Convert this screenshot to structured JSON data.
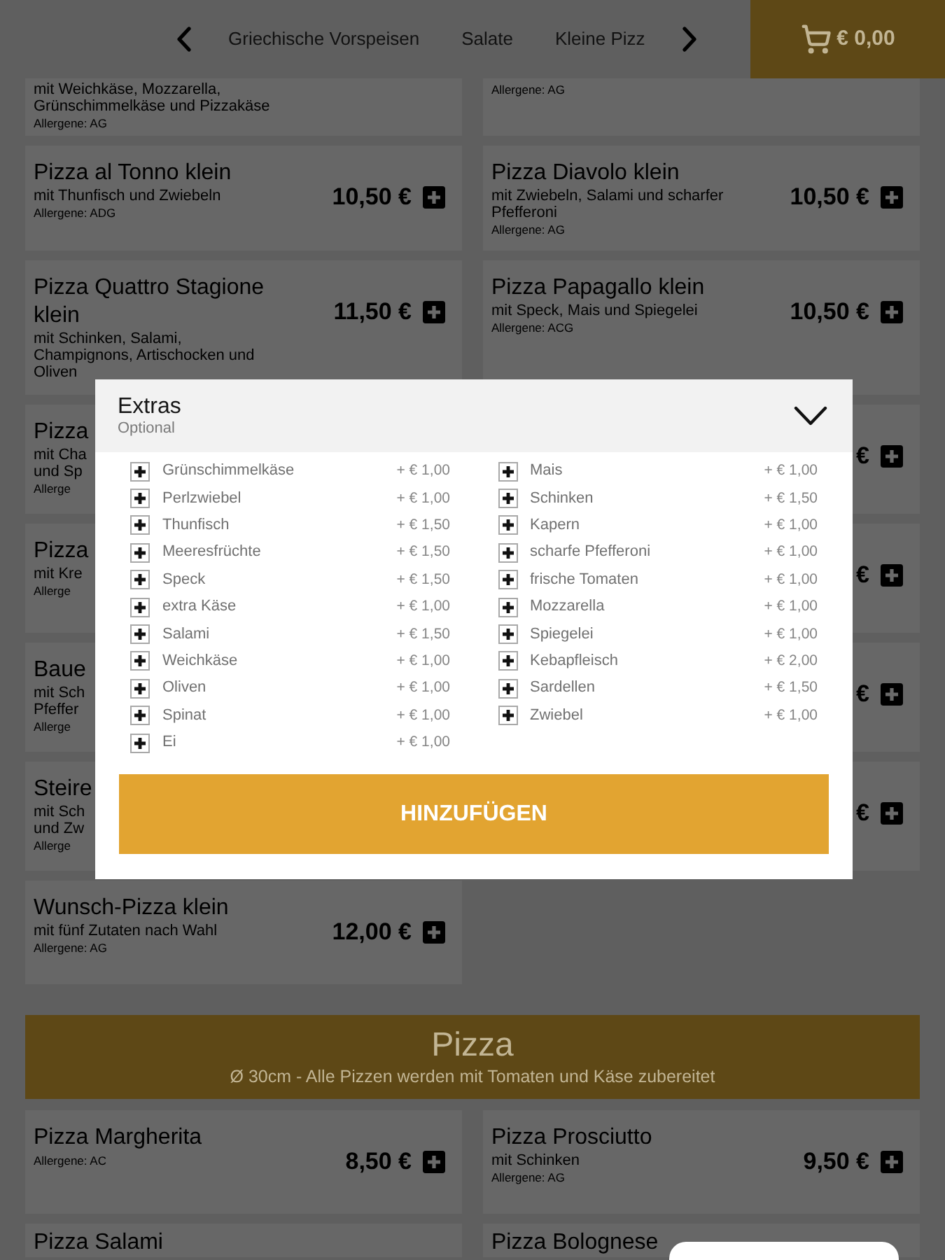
{
  "header": {
    "categories": [
      "Griechische Vorspeisen",
      "Salate",
      "Kleine Pizz"
    ],
    "cart_total": "€ 0,00"
  },
  "sections": [
    {
      "items": [
        {
          "kind": "cut_top",
          "description": "mit Weichkäse, Mozzarella, Grünschimmelkäse und Pizzakäse",
          "allergens": "Allergene: AG"
        },
        {
          "kind": "cut_top",
          "allergens": "Allergene: AG"
        },
        {
          "kind": "dish",
          "name": "Pizza al Tonno klein",
          "description": "mit Thunfisch und Zwiebeln",
          "allergens": "Allergene: ADG",
          "price": "10,50 €"
        },
        {
          "kind": "dish",
          "name": "Pizza Diavolo klein",
          "description": "mit Zwiebeln, Salami und scharfer Pfefferoni",
          "allergens": "Allergene: AG",
          "price": "10,50 €"
        },
        {
          "kind": "dish",
          "name": "Pizza Quattro Stagione klein",
          "description": "mit Schinken, Salami, Champignons, Artischocken und Oliven",
          "price": "11,50 €"
        },
        {
          "kind": "dish",
          "name": "Pizza Papagallo klein",
          "description": "mit Speck, Mais und Spiegelei",
          "allergens": "Allergene: ACG",
          "price": "10,50 €"
        },
        {
          "kind": "covered",
          "name": "Pizza",
          "description": "mit Cha und Sp",
          "allergens": "Allerge"
        },
        {
          "kind": "covered",
          "price": "€"
        },
        {
          "kind": "covered",
          "name": "Pizza",
          "description": "mit Kre",
          "allergens": "Allerge"
        },
        {
          "kind": "covered",
          "price": "€"
        },
        {
          "kind": "covered",
          "name": "Baue",
          "description": "mit Sch Pfeffer",
          "allergens": "Allerge"
        },
        {
          "kind": "covered",
          "price": "€"
        },
        {
          "kind": "covered",
          "name": "Steire",
          "description": "mit Sch und Zw",
          "allergens": "Allerge"
        },
        {
          "kind": "covered",
          "price": "€"
        },
        {
          "kind": "dish",
          "name": "Wunsch-Pizza klein",
          "description": "mit fünf Zutaten nach Wahl",
          "allergens": "Allergene: AG",
          "price": "12,00 €"
        }
      ]
    },
    {
      "title": "Pizza",
      "subtitle": "Ø 30cm - Alle Pizzen werden mit Tomaten und Käse zubereitet",
      "items": [
        {
          "kind": "dish",
          "name": "Pizza Margherita",
          "allergens": "Allergene: AC",
          "price": "8,50 €"
        },
        {
          "kind": "dish",
          "name": "Pizza Prosciutto",
          "description": "mit Schinken",
          "allergens": "Allergene: AG",
          "price": "9,50 €"
        },
        {
          "kind": "cut_bottom",
          "name": "Pizza Salami"
        },
        {
          "kind": "cut_bottom",
          "name": "Pizza Bolognese"
        }
      ]
    }
  ],
  "extras_dialog": {
    "title": "Extras",
    "subtitle": "Optional",
    "columns": [
      {
        "options": [
          {
            "name": "Grünschimmelkäse",
            "price": "+ € 1,00"
          },
          {
            "name": "Perlzwiebel",
            "price": "+ € 1,00"
          },
          {
            "name": "Thunfisch",
            "price": "+ € 1,50"
          },
          {
            "name": "Meeresfrüchte",
            "price": "+ € 1,50"
          },
          {
            "name": "Speck",
            "price": "+ € 1,50"
          },
          {
            "name": "extra Käse",
            "price": "+ € 1,00"
          },
          {
            "name": "Salami",
            "price": "+ € 1,50"
          },
          {
            "name": "Weichkäse",
            "price": "+ € 1,00"
          },
          {
            "name": "Oliven",
            "price": "+ € 1,00"
          },
          {
            "name": "Spinat",
            "price": "+ € 1,00"
          },
          {
            "name": "Ei",
            "price": "+ € 1,00"
          }
        ]
      },
      {
        "options": [
          {
            "name": "Mais",
            "price": "+ € 1,00"
          },
          {
            "name": "Schinken",
            "price": "+ € 1,50"
          },
          {
            "name": "Kapern",
            "price": "+ € 1,00"
          },
          {
            "name": "scharfe Pfefferoni",
            "price": "+ € 1,00"
          },
          {
            "name": "frische Tomaten",
            "price": "+ € 1,00"
          },
          {
            "name": "Mozzarella",
            "price": "+ € 1,00"
          },
          {
            "name": "Spiegelei",
            "price": "+ € 1,00"
          },
          {
            "name": "Kebapfleisch",
            "price": "+ € 2,00"
          },
          {
            "name": "Sardellen",
            "price": "+ € 1,50"
          },
          {
            "name": "Zwiebel",
            "price": "+ € 1,00"
          }
        ]
      }
    ],
    "button": "HINZUFÜGEN"
  }
}
